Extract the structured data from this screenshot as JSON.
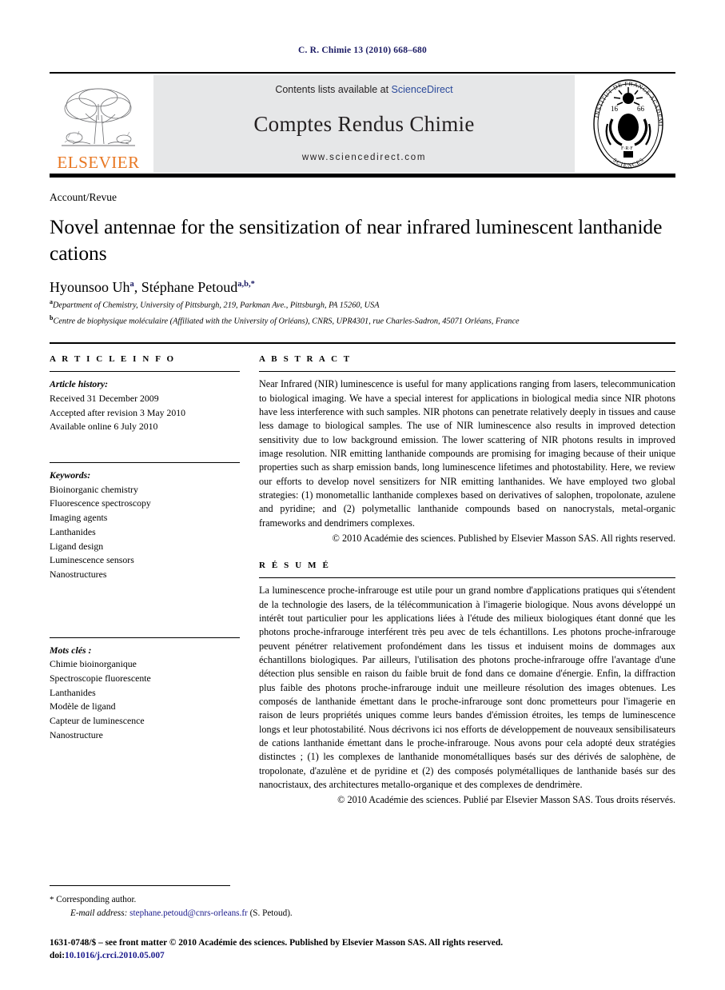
{
  "running_head": "C. R. Chimie 13 (2010) 668–680",
  "masthead": {
    "publisher_name": "ELSEVIER",
    "publisher_logo": "elsevier-tree-logo",
    "contents_prefix": "Contents lists available at ",
    "contents_link": "ScienceDirect",
    "journal_title": "Comptes Rendus Chimie",
    "url": "www.sciencedirect.com",
    "seal": {
      "name": "academie-des-sciences-seal",
      "top_text": "ACADEMIE DES",
      "bottom_text": "SCIENCES",
      "left_text": "INSTITUT DE FRANCE",
      "year": "1666"
    },
    "link_color": "#2b4a9b"
  },
  "article": {
    "doctype": "Account/Revue",
    "title": "Novel antennae for the sensitization of near infrared luminescent lanthanide cations",
    "authors": [
      {
        "name": "Hyounsoo Uh",
        "marks": "a"
      },
      {
        "name": "Stéphane Petoud",
        "marks": "a,b,*"
      }
    ],
    "affiliations": [
      {
        "mark": "a",
        "text": "Department of Chemistry, University of Pittsburgh, 219, Parkman Ave., Pittsburgh, PA 15260, USA"
      },
      {
        "mark": "b",
        "text": "Centre de biophysique moléculaire (Affiliated with the University of Orléans), CNRS, UPR4301, rue Charles-Sadron, 45071 Orléans, France"
      }
    ]
  },
  "info": {
    "heading": "A R T I C L E   I N F O",
    "history_label": "Article history:",
    "history": [
      "Received 31 December 2009",
      "Accepted after revision 3 May 2010",
      "Available online 6 July 2010"
    ],
    "keywords_label": "Keywords:",
    "keywords": [
      "Bioinorganic chemistry",
      "Fluorescence spectroscopy",
      "Imaging agents",
      "Lanthanides",
      "Ligand design",
      "Luminescence sensors",
      "Nanostructures"
    ],
    "motscles_label": "Mots clés :",
    "motscles": [
      "Chimie bioinorganique",
      "Spectroscopie fluorescente",
      "Lanthanides",
      "Modèle de ligand",
      "Capteur de luminescence",
      "Nanostructure"
    ]
  },
  "abstract": {
    "heading": "A B S T R A C T",
    "body": "Near Infrared (NIR) luminescence is useful for many applications ranging from lasers, telecommunication to biological imaging. We have a special interest for applications in biological media since NIR photons have less interference with such samples. NIR photons can penetrate relatively deeply in tissues and cause less damage to biological samples. The use of NIR luminescence also results in improved detection sensitivity due to low background emission. The lower scattering of NIR photons results in improved image resolution. NIR emitting lanthanide compounds are promising for imaging because of their unique properties such as sharp emission bands, long luminescence lifetimes and photostability. Here, we review our efforts to develop novel sensitizers for NIR emitting lanthanides. We have employed two global strategies: (1) monometallic lanthanide complexes based on derivatives of salophen, tropolonate, azulene and pyridine; and (2) polymetallic lanthanide compounds based on nanocrystals, metal-organic frameworks and dendrimers complexes.",
    "copyright": "© 2010 Académie des sciences. Published by Elsevier Masson SAS. All rights reserved."
  },
  "resume": {
    "heading": "R É S U M É",
    "body": "La luminescence proche-infrarouge est utile pour un grand nombre d'applications pratiques qui s'étendent de la technologie des lasers, de la télécommunication à l'imagerie biologique. Nous avons développé un intérêt tout particulier pour les applications liées à l'étude des milieux biologiques étant donné que les photons proche-infrarouge interférent très peu avec de tels échantillons. Les photons proche-infrarouge peuvent pénétrer relativement profondément dans les tissus et induisent moins de dommages aux échantillons biologiques. Par ailleurs, l'utilisation des photons proche-infrarouge offre l'avantage d'une détection plus sensible en raison du faible bruit de fond dans ce domaine d'énergie. Enfin, la diffraction plus faible des photons proche-infrarouge induit une meilleure résolution des images obtenues. Les composés de lanthanide émettant dans le proche-infrarouge sont donc prometteurs pour l'imagerie en raison de leurs propriétés uniques comme leurs bandes d'émission étroites, les temps de luminescence longs et leur photostabilité. Nous décrivons ici nos efforts de développement de nouveaux sensibilisateurs de cations lanthanide émettant dans le proche-infrarouge. Nous avons pour cela adopté deux stratégies distinctes ; (1) les complexes de lanthanide monométalliques basés sur des dérivés de salophène, de tropolonate, d'azulène et de pyridine et (2) des composés polymétalliques de lanthanide basés sur des nanocristaux, des architectures metallo-organique et des complexes de dendrimère.",
    "copyright": "© 2010 Académie des sciences. Publié par Elsevier Masson SAS. Tous droits réservés."
  },
  "footer": {
    "star": "*",
    "corresponding": "Corresponding author.",
    "email_label": "E-mail address:",
    "email": "stephane.petoud@cnrs-orleans.fr",
    "email_suffix": "(S. Petoud).",
    "imprint": "1631-0748/$ – see front matter © 2010 Académie des sciences. Published by Elsevier Masson SAS. All rights reserved.",
    "doi_label": "doi:",
    "doi_value": "10.1016/j.crci.2010.05.007"
  }
}
